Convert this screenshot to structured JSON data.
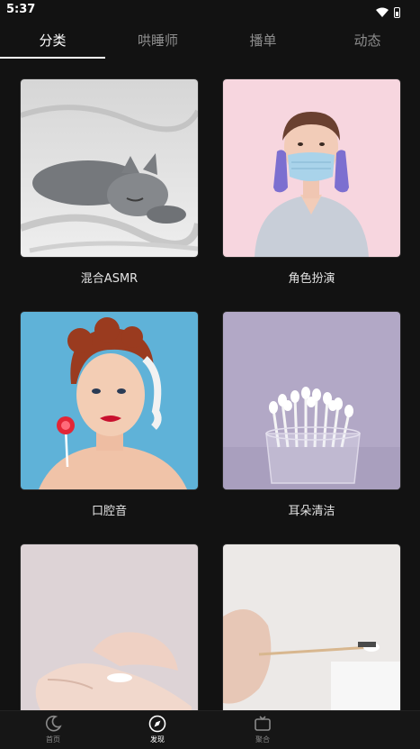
{
  "status_bar": {
    "time": "5:37"
  },
  "tabs": [
    {
      "label": "分类",
      "active": true
    },
    {
      "label": "哄睡师",
      "active": false
    },
    {
      "label": "播单",
      "active": false
    },
    {
      "label": "动态",
      "active": false
    }
  ],
  "categories": [
    {
      "label": "混合ASMR",
      "image": "sleeping-cat"
    },
    {
      "label": "角色扮演",
      "image": "nurse-with-mask"
    },
    {
      "label": "口腔音",
      "image": "woman-with-lollipop"
    },
    {
      "label": "耳朵清洁",
      "image": "cotton-swabs-in-glass"
    },
    {
      "label": "",
      "image": "hands-with-lotion"
    },
    {
      "label": "",
      "image": "hand-with-cotton-swab"
    }
  ],
  "bottom_nav": [
    {
      "label": "首页",
      "icon": "moon-icon",
      "active": false
    },
    {
      "label": "发现",
      "icon": "compass-icon",
      "active": true
    },
    {
      "label": "聚合",
      "icon": "tv-icon",
      "active": false
    }
  ],
  "colors": {
    "background": "#121212",
    "active_text": "#ffffff",
    "inactive_text": "#8d8d8d"
  }
}
